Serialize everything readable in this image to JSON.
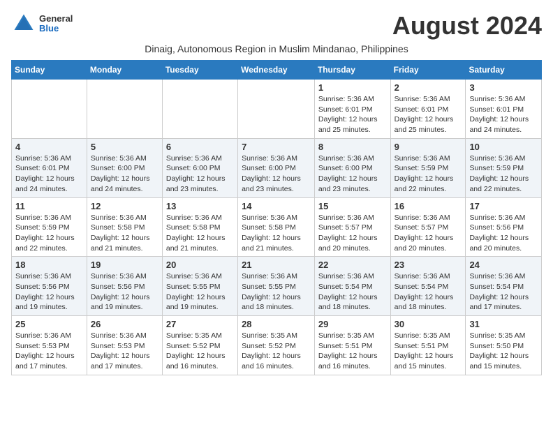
{
  "header": {
    "logo": {
      "general": "General",
      "blue": "Blue"
    },
    "month": "August 2024",
    "subtitle": "Dinaig, Autonomous Region in Muslim Mindanao, Philippines"
  },
  "weekdays": [
    "Sunday",
    "Monday",
    "Tuesday",
    "Wednesday",
    "Thursday",
    "Friday",
    "Saturday"
  ],
  "weeks": [
    [
      {
        "day": "",
        "info": ""
      },
      {
        "day": "",
        "info": ""
      },
      {
        "day": "",
        "info": ""
      },
      {
        "day": "",
        "info": ""
      },
      {
        "day": "1",
        "info": "Sunrise: 5:36 AM\nSunset: 6:01 PM\nDaylight: 12 hours\nand 25 minutes."
      },
      {
        "day": "2",
        "info": "Sunrise: 5:36 AM\nSunset: 6:01 PM\nDaylight: 12 hours\nand 25 minutes."
      },
      {
        "day": "3",
        "info": "Sunrise: 5:36 AM\nSunset: 6:01 PM\nDaylight: 12 hours\nand 24 minutes."
      }
    ],
    [
      {
        "day": "4",
        "info": "Sunrise: 5:36 AM\nSunset: 6:01 PM\nDaylight: 12 hours\nand 24 minutes."
      },
      {
        "day": "5",
        "info": "Sunrise: 5:36 AM\nSunset: 6:00 PM\nDaylight: 12 hours\nand 24 minutes."
      },
      {
        "day": "6",
        "info": "Sunrise: 5:36 AM\nSunset: 6:00 PM\nDaylight: 12 hours\nand 23 minutes."
      },
      {
        "day": "7",
        "info": "Sunrise: 5:36 AM\nSunset: 6:00 PM\nDaylight: 12 hours\nand 23 minutes."
      },
      {
        "day": "8",
        "info": "Sunrise: 5:36 AM\nSunset: 6:00 PM\nDaylight: 12 hours\nand 23 minutes."
      },
      {
        "day": "9",
        "info": "Sunrise: 5:36 AM\nSunset: 5:59 PM\nDaylight: 12 hours\nand 22 minutes."
      },
      {
        "day": "10",
        "info": "Sunrise: 5:36 AM\nSunset: 5:59 PM\nDaylight: 12 hours\nand 22 minutes."
      }
    ],
    [
      {
        "day": "11",
        "info": "Sunrise: 5:36 AM\nSunset: 5:59 PM\nDaylight: 12 hours\nand 22 minutes."
      },
      {
        "day": "12",
        "info": "Sunrise: 5:36 AM\nSunset: 5:58 PM\nDaylight: 12 hours\nand 21 minutes."
      },
      {
        "day": "13",
        "info": "Sunrise: 5:36 AM\nSunset: 5:58 PM\nDaylight: 12 hours\nand 21 minutes."
      },
      {
        "day": "14",
        "info": "Sunrise: 5:36 AM\nSunset: 5:58 PM\nDaylight: 12 hours\nand 21 minutes."
      },
      {
        "day": "15",
        "info": "Sunrise: 5:36 AM\nSunset: 5:57 PM\nDaylight: 12 hours\nand 20 minutes."
      },
      {
        "day": "16",
        "info": "Sunrise: 5:36 AM\nSunset: 5:57 PM\nDaylight: 12 hours\nand 20 minutes."
      },
      {
        "day": "17",
        "info": "Sunrise: 5:36 AM\nSunset: 5:56 PM\nDaylight: 12 hours\nand 20 minutes."
      }
    ],
    [
      {
        "day": "18",
        "info": "Sunrise: 5:36 AM\nSunset: 5:56 PM\nDaylight: 12 hours\nand 19 minutes."
      },
      {
        "day": "19",
        "info": "Sunrise: 5:36 AM\nSunset: 5:56 PM\nDaylight: 12 hours\nand 19 minutes."
      },
      {
        "day": "20",
        "info": "Sunrise: 5:36 AM\nSunset: 5:55 PM\nDaylight: 12 hours\nand 19 minutes."
      },
      {
        "day": "21",
        "info": "Sunrise: 5:36 AM\nSunset: 5:55 PM\nDaylight: 12 hours\nand 18 minutes."
      },
      {
        "day": "22",
        "info": "Sunrise: 5:36 AM\nSunset: 5:54 PM\nDaylight: 12 hours\nand 18 minutes."
      },
      {
        "day": "23",
        "info": "Sunrise: 5:36 AM\nSunset: 5:54 PM\nDaylight: 12 hours\nand 18 minutes."
      },
      {
        "day": "24",
        "info": "Sunrise: 5:36 AM\nSunset: 5:54 PM\nDaylight: 12 hours\nand 17 minutes."
      }
    ],
    [
      {
        "day": "25",
        "info": "Sunrise: 5:36 AM\nSunset: 5:53 PM\nDaylight: 12 hours\nand 17 minutes."
      },
      {
        "day": "26",
        "info": "Sunrise: 5:36 AM\nSunset: 5:53 PM\nDaylight: 12 hours\nand 17 minutes."
      },
      {
        "day": "27",
        "info": "Sunrise: 5:35 AM\nSunset: 5:52 PM\nDaylight: 12 hours\nand 16 minutes."
      },
      {
        "day": "28",
        "info": "Sunrise: 5:35 AM\nSunset: 5:52 PM\nDaylight: 12 hours\nand 16 minutes."
      },
      {
        "day": "29",
        "info": "Sunrise: 5:35 AM\nSunset: 5:51 PM\nDaylight: 12 hours\nand 16 minutes."
      },
      {
        "day": "30",
        "info": "Sunrise: 5:35 AM\nSunset: 5:51 PM\nDaylight: 12 hours\nand 15 minutes."
      },
      {
        "day": "31",
        "info": "Sunrise: 5:35 AM\nSunset: 5:50 PM\nDaylight: 12 hours\nand 15 minutes."
      }
    ]
  ]
}
